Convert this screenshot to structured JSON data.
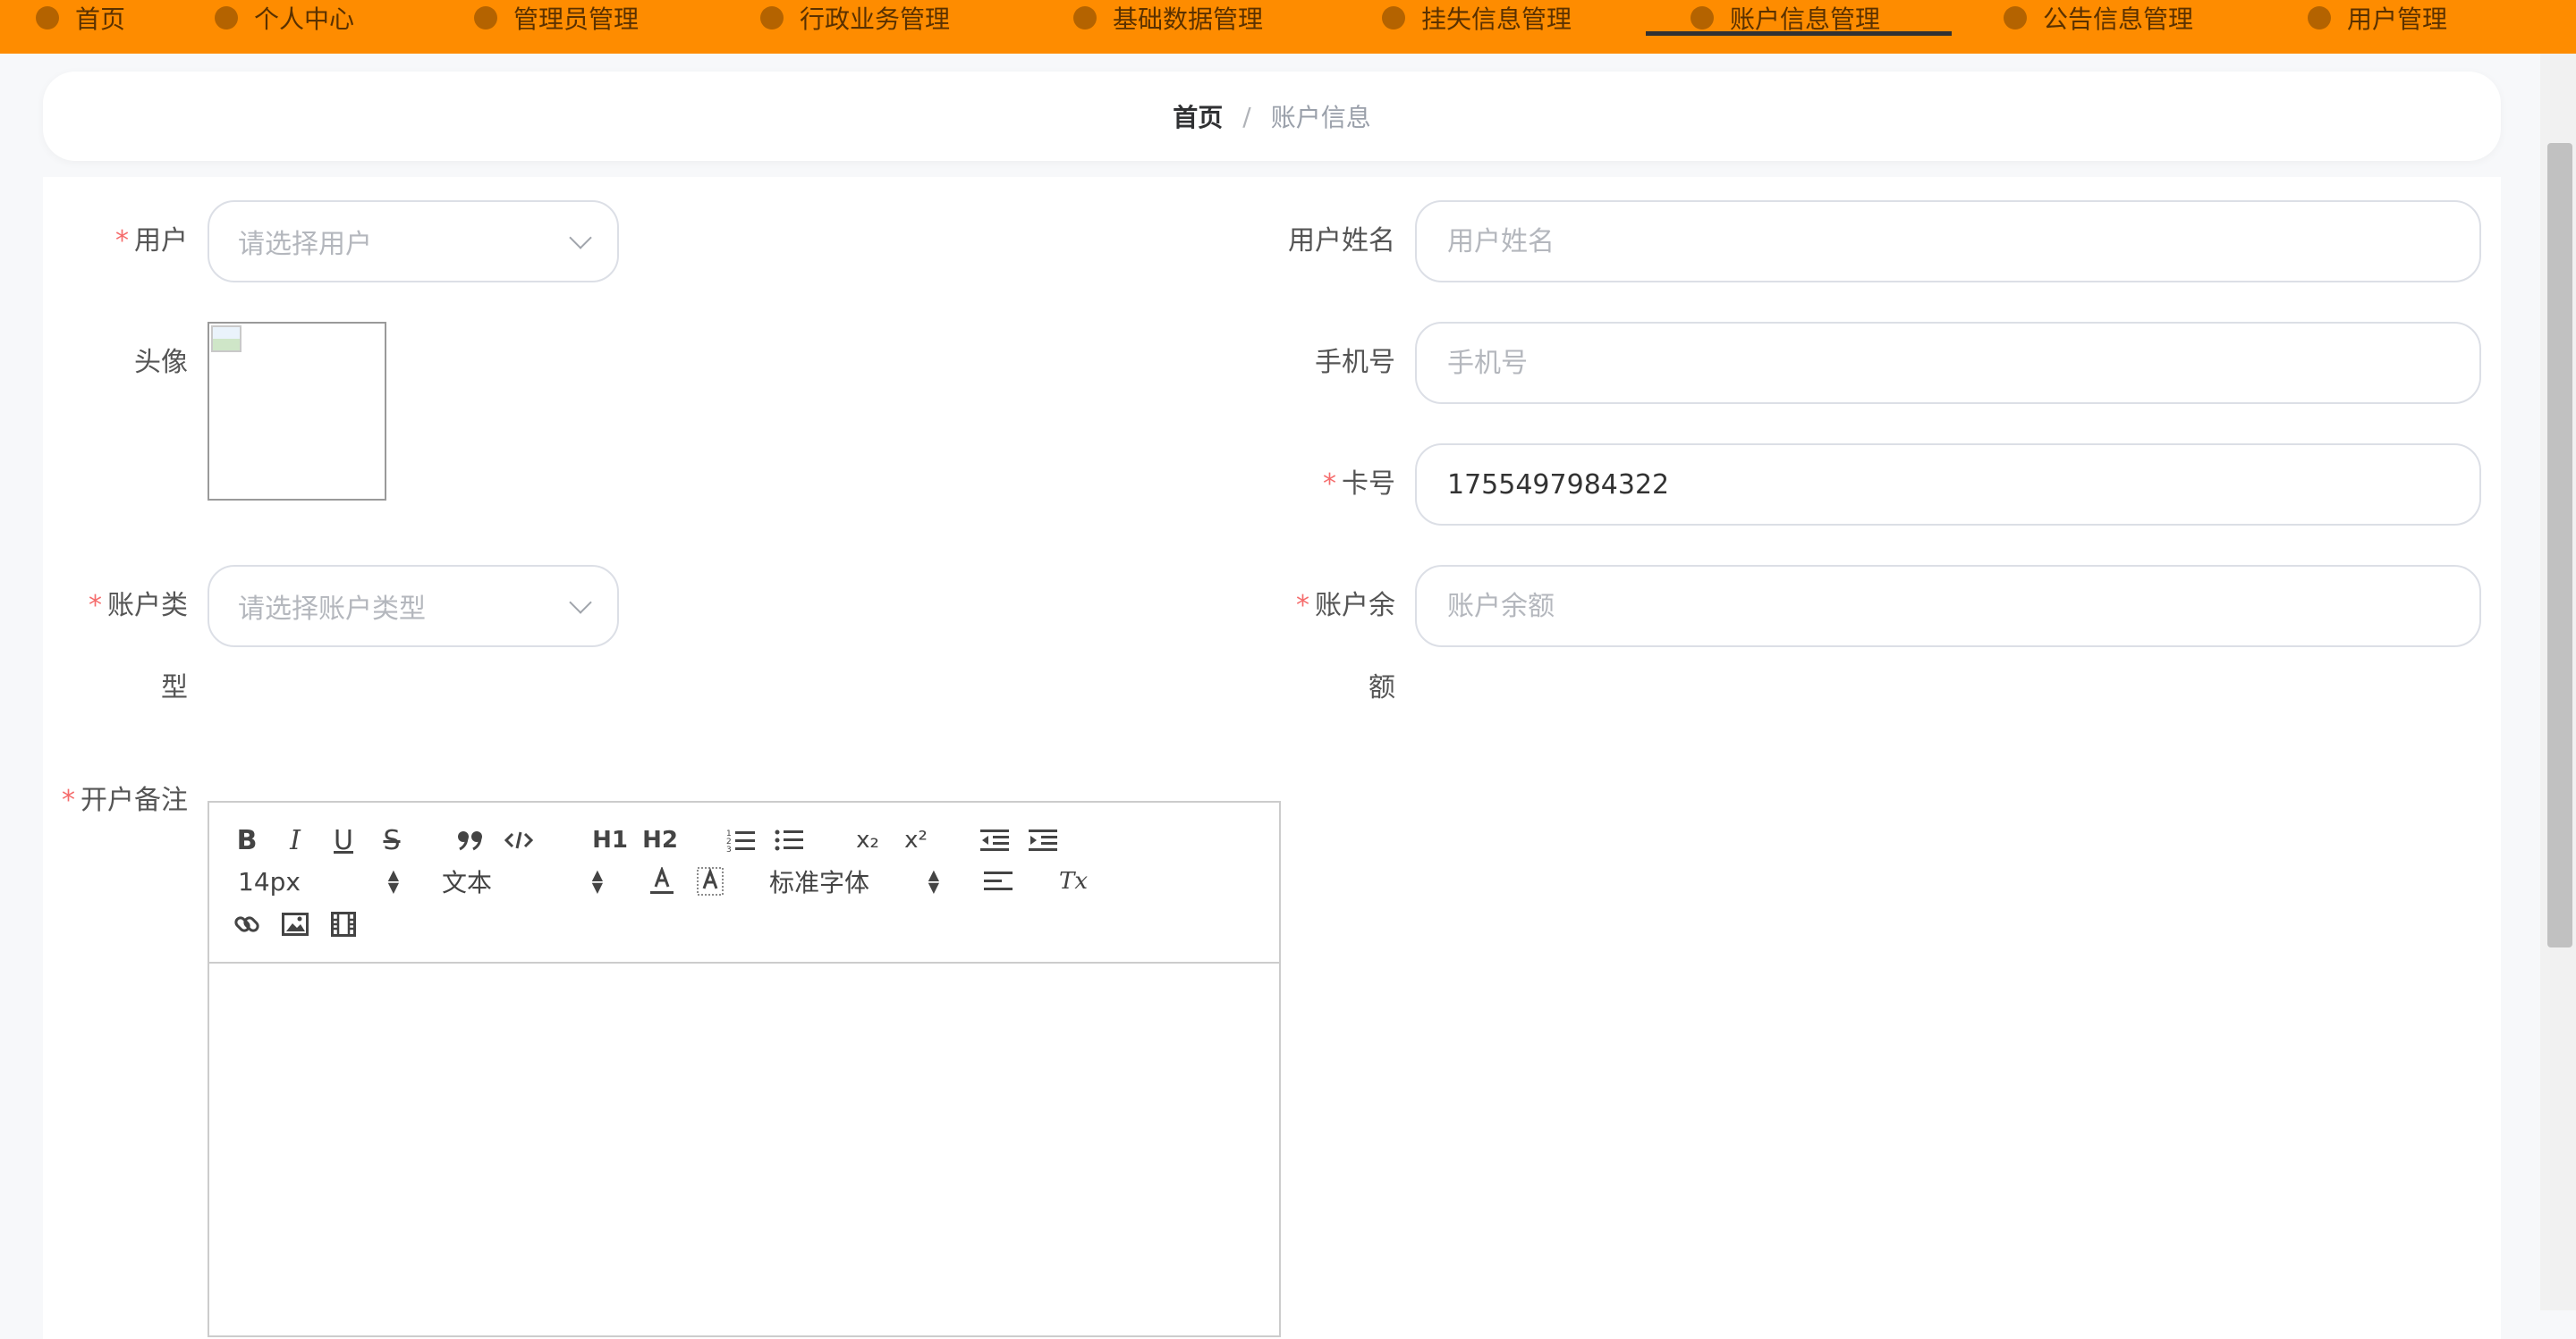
{
  "nav": {
    "items": [
      {
        "label": "首页"
      },
      {
        "label": "个人中心"
      },
      {
        "label": "管理员管理"
      },
      {
        "label": "行政业务管理"
      },
      {
        "label": "基础数据管理"
      },
      {
        "label": "挂失信息管理"
      },
      {
        "label": "账户信息管理",
        "active": true
      },
      {
        "label": "公告信息管理"
      },
      {
        "label": "用户管理"
      }
    ],
    "color": "#fe8c00"
  },
  "breadcrumb": {
    "home": "首页",
    "separator": "/",
    "current": "账户信息"
  },
  "form": {
    "user": {
      "label": "用户",
      "placeholder": "请选择用户"
    },
    "user_name": {
      "label": "用户姓名",
      "placeholder": "用户姓名"
    },
    "avatar": {
      "label": "头像"
    },
    "phone": {
      "label": "手机号",
      "placeholder": "手机号"
    },
    "card": {
      "label": "卡号",
      "value": "1755497984322"
    },
    "account_type": {
      "label_line1": "账户类",
      "label_line2": "型",
      "placeholder": "请选择账户类型"
    },
    "balance": {
      "label_line1": "账户余",
      "label_line2": "额",
      "placeholder": "账户余额"
    },
    "remark": {
      "label": "开户备注"
    },
    "required_mark": "*"
  },
  "editor": {
    "font_size": "14px",
    "text_type": "文本",
    "font_family": "标准字体",
    "buttons": {
      "bold": "B",
      "italic": "I",
      "underline": "U",
      "strike": "S",
      "h1": "H1",
      "h2": "H2",
      "sub": "x₂",
      "sup": "x²",
      "clean": "Tx"
    }
  }
}
